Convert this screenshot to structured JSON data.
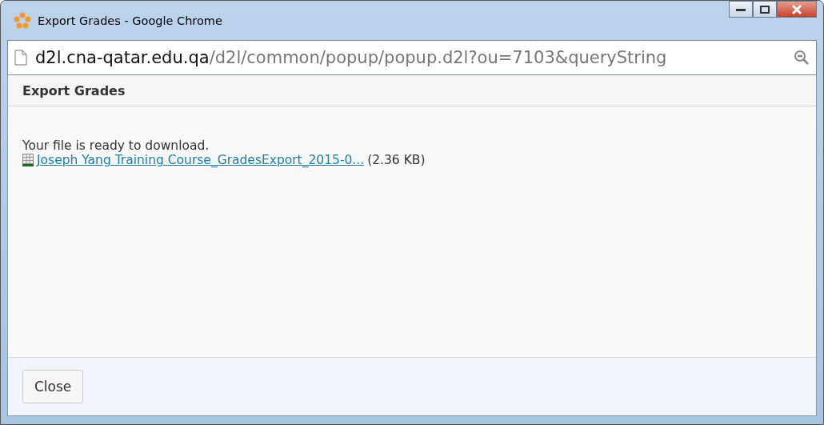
{
  "window": {
    "title": "Export Grades - Google Chrome"
  },
  "address_bar": {
    "domain": "d2l.cna-qatar.edu.qa",
    "path": "/d2l/common/popup/popup.d2l?ou=7103&queryString"
  },
  "dialog": {
    "title": "Export Grades",
    "message": "Your file is ready to download.",
    "file": {
      "name": "Joseph Yang Training Course_GradesExport_2015-0...",
      "size": "(2.36 KB)"
    }
  },
  "buttons": [
    "Close"
  ]
}
